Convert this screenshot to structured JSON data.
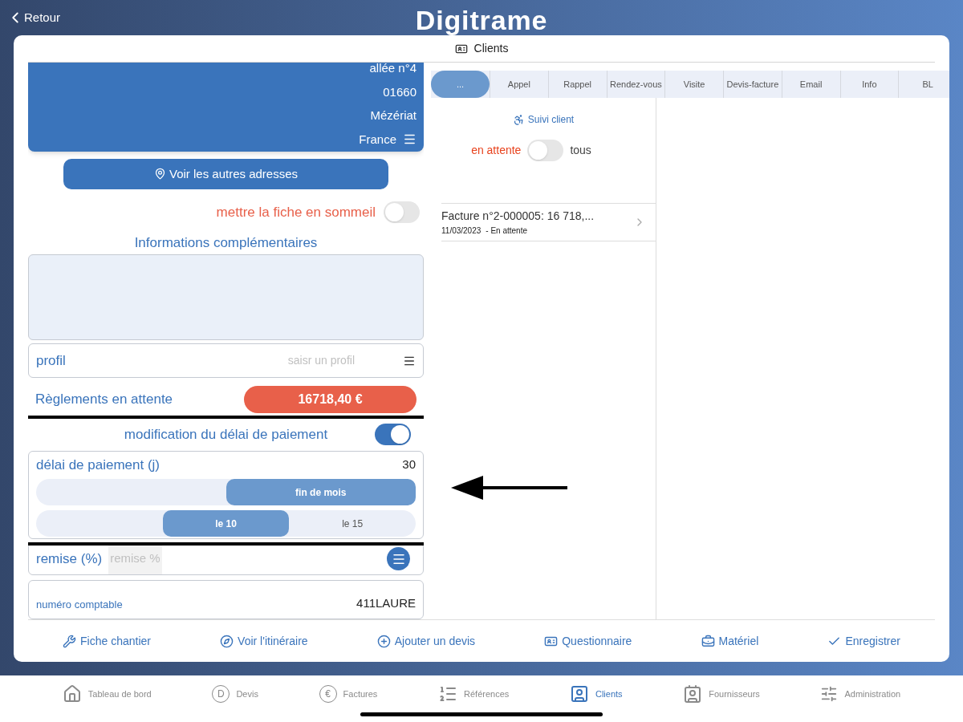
{
  "header": {
    "back": "Retour",
    "logo": "Digitrame"
  },
  "card_title": "Clients",
  "address": {
    "lines": [
      "allée n°4",
      "01660",
      "Mézériat",
      "France"
    ]
  },
  "other_addresses_button": "Voir les autres adresses",
  "sleep": {
    "label": "mettre la fiche en sommeil",
    "on": false
  },
  "info": {
    "label": "Informations complémentaires"
  },
  "profile": {
    "label": "profil",
    "placeholder": "saisr un profil"
  },
  "pending": {
    "label": "Règlements en attente",
    "amount": "16718,40 €"
  },
  "payment_delay": {
    "label": "modification du délai de paiement",
    "on": true,
    "field_label": "délai de paiement (j)",
    "value": "30",
    "row1": [
      {
        "label": "fin de mois",
        "selected": true
      }
    ],
    "row2": [
      {
        "label": "le 10",
        "selected": true
      },
      {
        "label": "le 15",
        "selected": false
      }
    ]
  },
  "discount": {
    "label": "remise (%)",
    "placeholder": "remise %"
  },
  "account": {
    "label": "numéro comptable",
    "value": "411LAURE"
  },
  "tabs": [
    {
      "label": "...",
      "selected": true
    },
    {
      "label": "Appel",
      "selected": false
    },
    {
      "label": "Rappel",
      "selected": false
    },
    {
      "label": "Rendez-vous",
      "selected": false
    },
    {
      "label": "Visite",
      "selected": false
    },
    {
      "label": "Devis-facture",
      "selected": false
    },
    {
      "label": "Email",
      "selected": false
    },
    {
      "label": "Info",
      "selected": false
    },
    {
      "label": "BL",
      "selected": false
    }
  ],
  "follow_up": "Suivi client",
  "filter": {
    "left": "en attente",
    "right": "tous",
    "on": false
  },
  "invoices": [
    {
      "title": "Facture n°2-000005: 16 718,...",
      "date": "11/03/2023",
      "status": "- En attente"
    }
  ],
  "actions": [
    {
      "kind": "wrench",
      "label": "Fiche chantier"
    },
    {
      "kind": "compass",
      "label": "Voir l'itinéraire"
    },
    {
      "kind": "plus",
      "label": "Ajouter un devis"
    },
    {
      "kind": "form",
      "label": "Questionnaire"
    },
    {
      "kind": "case",
      "label": "Matériel"
    },
    {
      "kind": "check",
      "label": "Enregistrer"
    }
  ],
  "nav": [
    {
      "kind": "home",
      "label": "Tableau de bord",
      "selected": false
    },
    {
      "kind": "letter",
      "glyph": "D",
      "label": "Devis",
      "selected": false
    },
    {
      "kind": "letter",
      "glyph": "€",
      "label": "Factures",
      "selected": false
    },
    {
      "kind": "list",
      "label": "Références",
      "selected": false
    },
    {
      "kind": "client",
      "label": "Clients",
      "selected": true
    },
    {
      "kind": "supplier",
      "label": "Fournisseurs",
      "selected": false
    },
    {
      "kind": "sliders",
      "label": "Administration",
      "selected": false
    }
  ]
}
